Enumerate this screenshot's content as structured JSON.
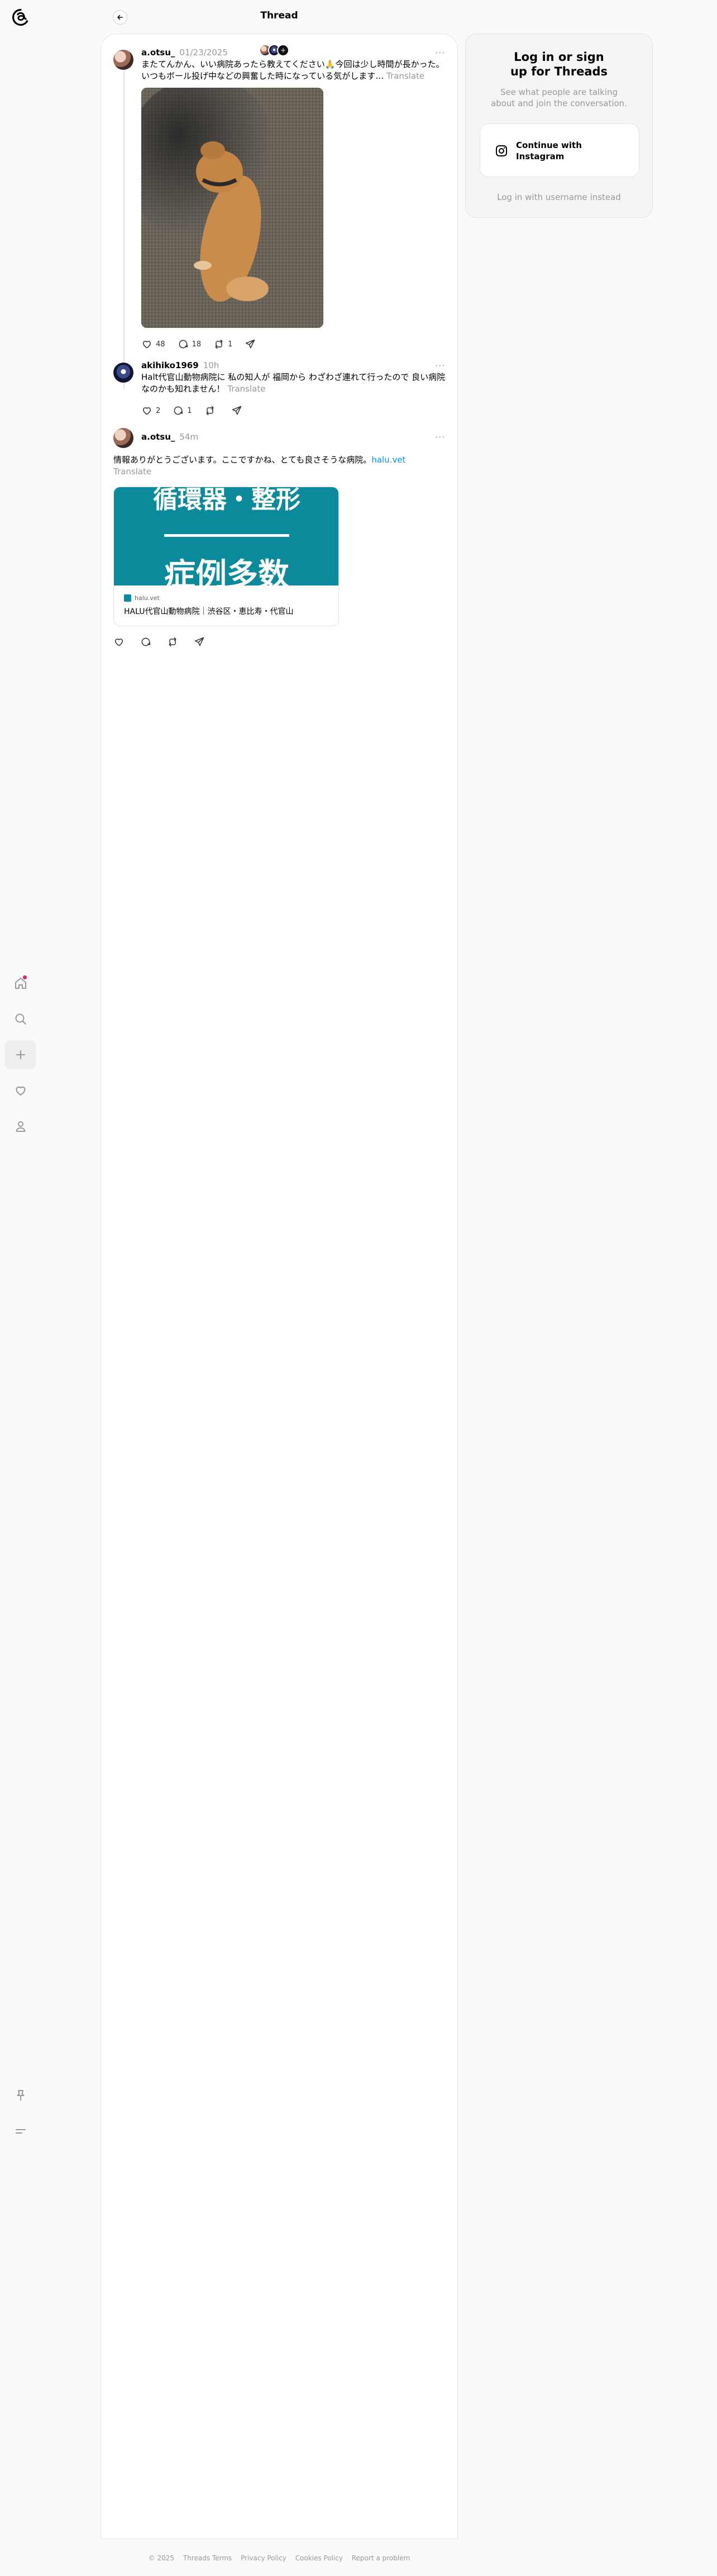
{
  "header": {
    "title": "Thread",
    "back_icon": "arrow-left-icon"
  },
  "nav": {
    "items": [
      {
        "name": "home-icon",
        "has_badge": true
      },
      {
        "name": "search-icon"
      },
      {
        "name": "plus-icon"
      },
      {
        "name": "heart-icon"
      },
      {
        "name": "profile-icon"
      }
    ],
    "bottom": [
      {
        "name": "pin-icon"
      },
      {
        "name": "menu-icon"
      }
    ]
  },
  "posts": [
    {
      "username": "a.otsu_",
      "time": "01/23/2025",
      "text": "またてんかん、いい病院あったら教えてください🙏今回は少し時間が長かった。いつもボール投げ中などの興奮した時になっている気がします…",
      "translate": "Translate",
      "likes": "48",
      "comments": "18",
      "reposts": "1"
    },
    {
      "username": "akihiko1969",
      "time": "10h",
      "text": "Halt代官山動物病院に 私の知人が 福岡から わざわざ連れて行ったので 良い病院なのかも知れません！",
      "translate": "Translate",
      "likes": "2",
      "comments": "1"
    },
    {
      "username": "a.otsu_",
      "time": "54m",
      "text": "情報ありがとうございます。ここですかね、とても良さそうな病院。",
      "link": "halu.vet",
      "translate": "Translate",
      "card": {
        "image_text_1": "循環器・整形",
        "image_text_2": "症例多数",
        "domain": "halu.vet",
        "title": "HALU代官山動物病院｜渋谷区・恵比寿・代官山"
      }
    }
  ],
  "login": {
    "title": "Log in or sign up for Threads",
    "subtitle": "See what people are talking about and join the conversation.",
    "instagram_button": "Continue with Instagram",
    "username_link": "Log in with username instead"
  },
  "footer": [
    "© 2025",
    "Threads Terms",
    "Privacy Policy",
    "Cookies Policy",
    "Report a problem"
  ]
}
